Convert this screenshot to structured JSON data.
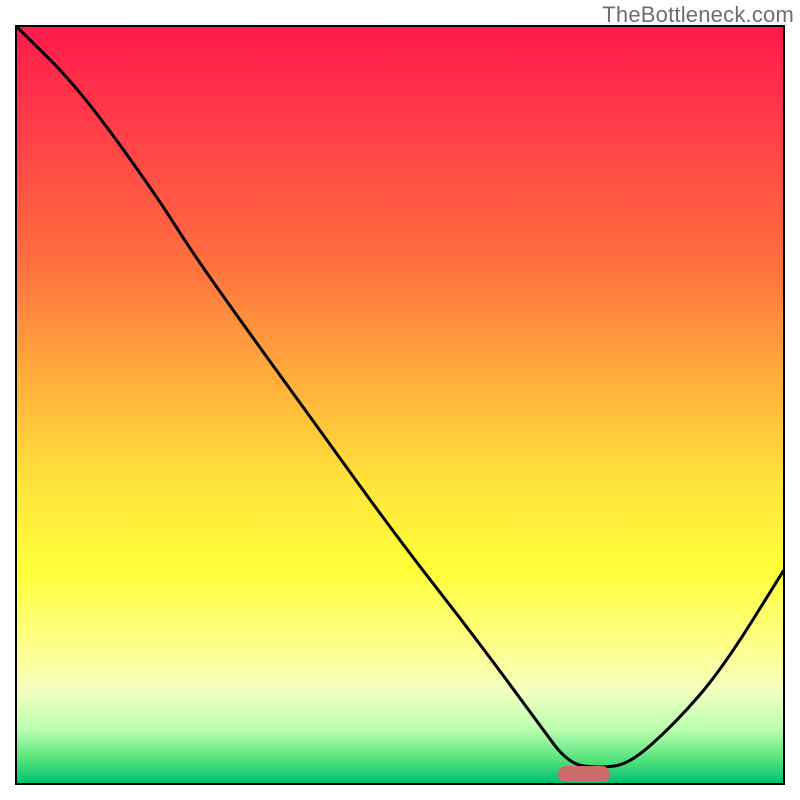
{
  "watermark": "TheBottleneck.com",
  "chart_data": {
    "type": "line",
    "title": "",
    "xlabel": "",
    "ylabel": "",
    "xlim": [
      0,
      100
    ],
    "ylim": [
      0,
      100
    ],
    "description": "Bottleneck curve over a red-to-green vertical gradient. Lower is better. The curve descends from top-left, reaches a minimum near x≈74 (green zone), then rises toward the right edge.",
    "series": [
      {
        "name": "bottleneck-curve",
        "x": [
          0,
          8,
          18,
          23,
          30,
          40,
          50,
          60,
          68,
          72,
          76,
          80,
          86,
          92,
          100
        ],
        "y": [
          100,
          92,
          78,
          70,
          60,
          46,
          32,
          19,
          8,
          2.5,
          2,
          2.5,
          8,
          15,
          28
        ]
      }
    ],
    "optimal_marker": {
      "x": 74,
      "y": 1.2,
      "color": "#cf6a6a"
    },
    "gradient_stops": [
      {
        "pos": 0,
        "color": "#ff1a4b"
      },
      {
        "pos": 12,
        "color": "#ff3a4a"
      },
      {
        "pos": 30,
        "color": "#ff6b3f"
      },
      {
        "pos": 48,
        "color": "#ffb33a"
      },
      {
        "pos": 60,
        "color": "#ffe23a"
      },
      {
        "pos": 72,
        "color": "#ffff3a"
      },
      {
        "pos": 82,
        "color": "#feff8c"
      },
      {
        "pos": 88,
        "color": "#f2ffc0"
      },
      {
        "pos": 93,
        "color": "#b8ffb0"
      },
      {
        "pos": 97,
        "color": "#52e27a"
      },
      {
        "pos": 100,
        "color": "#00c172"
      }
    ]
  }
}
